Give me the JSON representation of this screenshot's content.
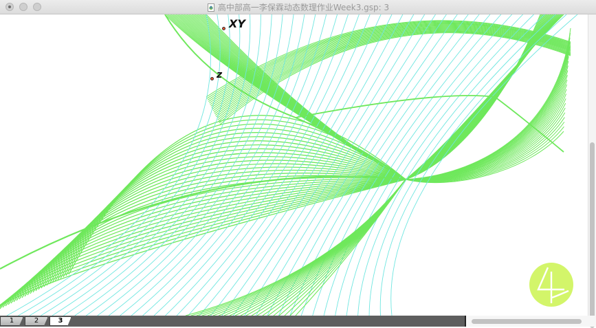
{
  "window": {
    "title": "高中部高一李保霖动态数理作业Week3.gsp: 3",
    "document_icon": "gsp-document-icon"
  },
  "traffic_lights": [
    "close",
    "minimize",
    "zoom"
  ],
  "canvas": {
    "points": [
      {
        "label": "XY",
        "id": "point-xy"
      },
      {
        "label": "z",
        "id": "point-z"
      }
    ],
    "surface_colors": {
      "grid_a": "#6fe85c",
      "grid_b": "#6ee6e0"
    },
    "logo_color": "#d3f56a"
  },
  "page_tabs": [
    {
      "label": "1",
      "active": false
    },
    {
      "label": "2",
      "active": false
    },
    {
      "label": "3",
      "active": true
    }
  ],
  "icons": {
    "logo": "sketchpad-logo-icon"
  }
}
